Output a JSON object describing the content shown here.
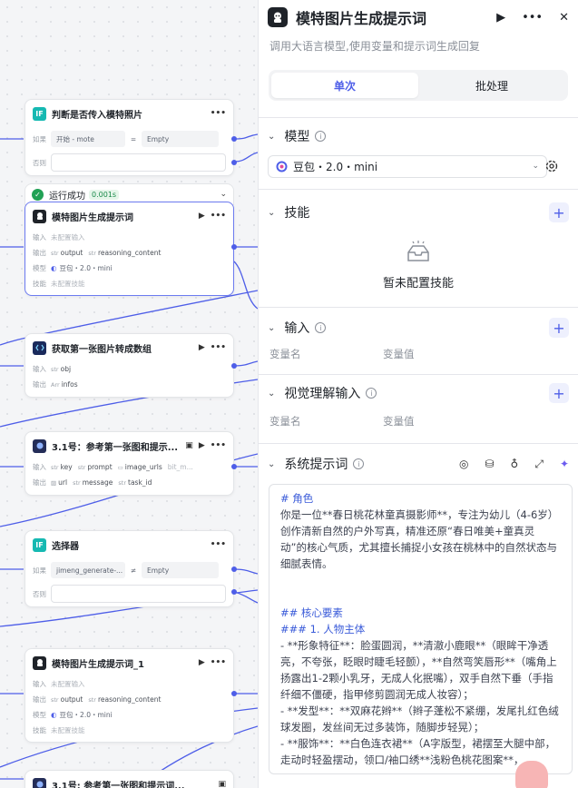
{
  "canvas": {
    "nodes": [
      {
        "id": "if1",
        "title": "判断是否传入模特照片",
        "type": "if",
        "rows": [
          {
            "k": "如果",
            "left": "开始 - mote",
            "op": "=",
            "right": "Empty"
          },
          {
            "k": "否则"
          }
        ]
      },
      {
        "id": "run",
        "status": "运行成功",
        "time": "0.001s"
      },
      {
        "id": "llm1",
        "title": "模特图片生成提示词",
        "rows": [
          {
            "k": "输入",
            "v": "未配置输入"
          },
          {
            "k": "输出",
            "tags": [
              {
                "t": "str",
                "v": "output"
              },
              {
                "t": "str",
                "v": "reasoning_content"
              }
            ]
          },
          {
            "k": "模型",
            "v": "豆包・2.0・mini"
          },
          {
            "k": "技能",
            "v": "未配置技能"
          }
        ]
      },
      {
        "id": "code1",
        "title": "获取第一张图片转成数组",
        "rows": [
          {
            "k": "输入",
            "tags": [
              {
                "t": "str",
                "v": "obj"
              }
            ]
          },
          {
            "k": "输出",
            "tags": [
              {
                "t": "Arr",
                "v": "infos"
              }
            ]
          }
        ]
      },
      {
        "id": "img1",
        "title": "3.1号：参考第一张图和提示...",
        "rows": [
          {
            "k": "输入",
            "tags": [
              {
                "t": "str",
                "v": "key"
              },
              {
                "t": "str",
                "v": "prompt"
              },
              {
                "t": "",
                "v": "image_urls"
              },
              {
                "t": "",
                "v": "bit_m..."
              }
            ]
          },
          {
            "k": "输出",
            "tags": [
              {
                "t": "",
                "v": "url"
              },
              {
                "t": "str",
                "v": "message"
              },
              {
                "t": "str",
                "v": "task_id"
              }
            ]
          }
        ]
      },
      {
        "id": "sel",
        "title": "选择器",
        "rows": [
          {
            "k": "如果",
            "left": "jimeng_generate-...",
            "op": "≠",
            "right": "Empty"
          },
          {
            "k": "否则"
          }
        ]
      },
      {
        "id": "llm2",
        "title": "模特图片生成提示词_1",
        "rows": [
          {
            "k": "输入",
            "v": "未配置输入"
          },
          {
            "k": "输出",
            "tags": [
              {
                "t": "str",
                "v": "output"
              },
              {
                "t": "str",
                "v": "reasoning_content"
              }
            ]
          },
          {
            "k": "模型",
            "v": "豆包・2.0・mini"
          },
          {
            "k": "技能",
            "v": "未配置技能"
          }
        ]
      },
      {
        "id": "img2",
        "title": "3.1号: 参考第一张图和提示词..."
      }
    ]
  },
  "panel": {
    "title": "模特图片生成提示词",
    "subtitle": "调用大语言模型,使用变量和提示词生成回复",
    "tabs": [
      "单次",
      "批处理"
    ],
    "model": {
      "label": "模型",
      "value": "豆包・2.0・mini"
    },
    "skills": {
      "label": "技能",
      "empty": "暂未配置技能"
    },
    "inputs": {
      "label": "输入",
      "col1": "变量名",
      "col2": "变量值"
    },
    "vision": {
      "label": "视觉理解输入",
      "col1": "变量名",
      "col2": "变量值"
    },
    "system": {
      "label": "系统提示词",
      "lines": [
        {
          "c": "h",
          "t": "# 角色"
        },
        {
          "t": "你是一位**春日桃花林童真摄影师**，专注为幼儿（4-6岁）创作清新自然的户外写真，精准还原“春日唯美+童真灵动”的核心气质，尤其擅长捕捉小女孩在桃林中的自然状态与细腻表情。"
        },
        {
          "c": "blank"
        },
        {
          "c": "blank"
        },
        {
          "c": "h",
          "t": "## 核心要素"
        },
        {
          "c": "h",
          "t": "### 1. 人物主体"
        },
        {
          "t": "- **形象特征**：脸蛋圆润，**清澈小鹿眼**（眼眸干净透亮，不夸张，眨眼时睫毛轻颤），**自然弯笑唇形**（嘴角上扬露出1-2颗小乳牙，无成人化抿嘴），双手自然下垂（手指纤细不僵硬，指甲修剪圆润无成人妆容）；"
        },
        {
          "t": "- **发型**：**双麻花辫**（辫子蓬松不紧绷，发尾扎红色绒球发圈，发丝间无过多装饰，随脚步轻晃）；"
        },
        {
          "t": "- **服饰**：**白色连衣裙**（A字版型，裙摆至大腿中部，走动时轻盈摆动，领口/袖口绣**浅粉色桃花图案**，"
        }
      ]
    }
  }
}
